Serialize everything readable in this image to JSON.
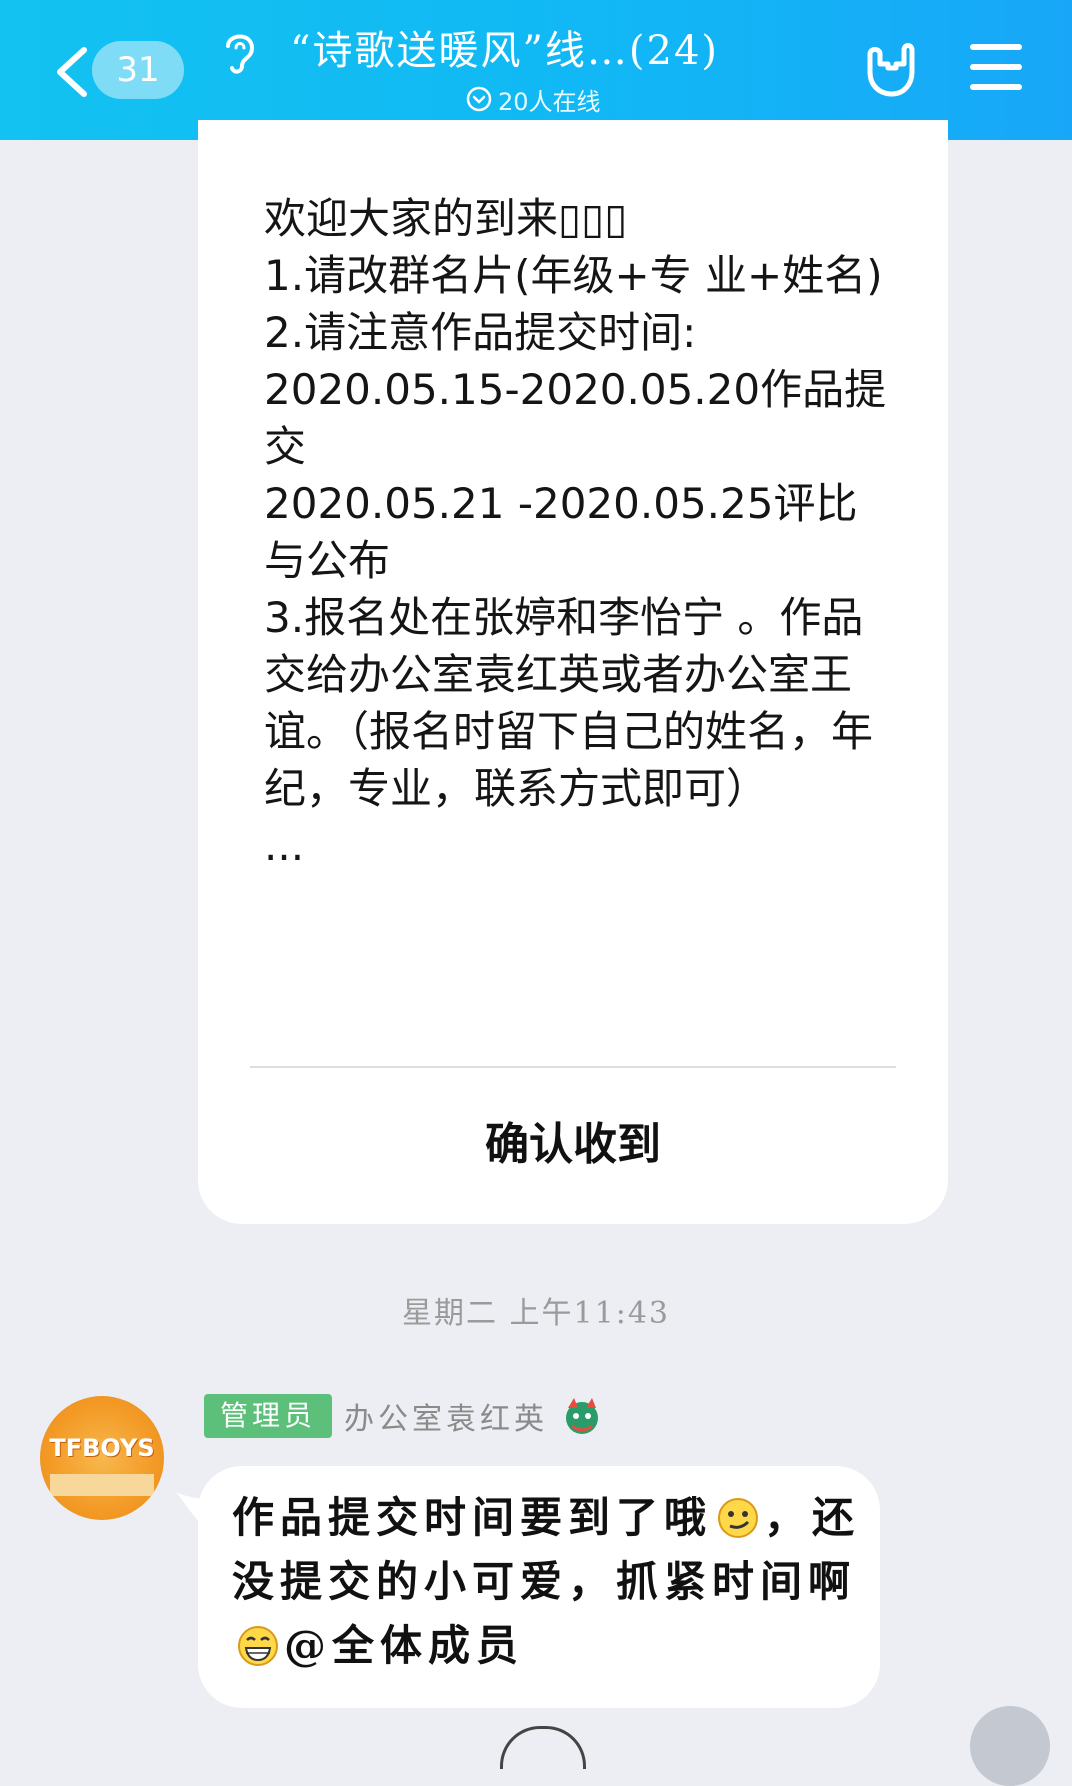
{
  "header": {
    "back_count": "31",
    "title": "“诗歌送暖风”线…(24)",
    "online": "20人在线"
  },
  "notice": {
    "text": "欢迎大家的到来▯▯▯\n1.请改群名片(年级+专 业+姓名)\n2.请注意作品提交时间:\n2020.05.15-2020.05.20作品提交\n2020.05.21 -2020.05.25评比与公布\n3.报名处在张婷和李怡宁 。作品交给办公室袁红英或者办公室王谊。（报名时留下自己的姓名，年纪，专业，联系方式即可）\n...",
    "confirm_label": "确认收到"
  },
  "timestamp": "星期二 上午11:43",
  "message": {
    "avatar_text": "TFBOYS",
    "role_badge": "管理员",
    "sender": "办公室袁红英",
    "text_part1": "作品提交时间要到了哦",
    "text_part2": "，还没提交的小可爱，抓紧时间啊",
    "text_part3": "@全体成员",
    "icons": [
      "ear-icon",
      "rock-hand-icon",
      "menu-icon",
      "dragon-icon",
      "smirk-emoji",
      "grin-emoji"
    ]
  },
  "colors": {
    "header": "#13c2f0",
    "background": "#eceef3",
    "badge": "#5cc07a"
  }
}
